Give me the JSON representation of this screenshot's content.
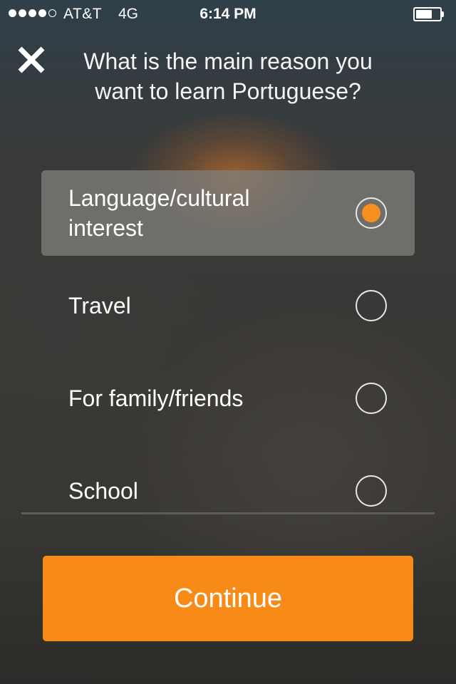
{
  "status_bar": {
    "signal_icon": "signal-strength-icon",
    "carrier": "AT&T",
    "network": "4G",
    "time": "6:14 PM",
    "battery_icon": "battery-icon"
  },
  "header": {
    "close_icon": "close-icon",
    "question": "What is the main reason you want to learn Portuguese?"
  },
  "options": [
    {
      "label": "Language/cultural interest",
      "selected": true
    },
    {
      "label": "Travel",
      "selected": false
    },
    {
      "label": "For family/friends",
      "selected": false
    },
    {
      "label": "School",
      "selected": false
    }
  ],
  "footer": {
    "continue_label": "Continue"
  },
  "colors": {
    "accent": "#f88b18",
    "selected_row": "#7d7d7a",
    "text": "#ffffff"
  }
}
